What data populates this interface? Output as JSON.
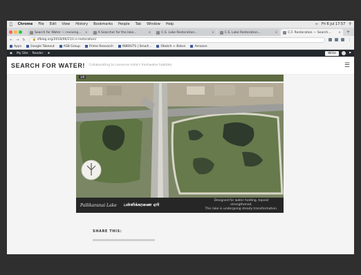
{
  "menubar": {
    "app": "Chrome",
    "items": [
      "File",
      "Edit",
      "View",
      "History",
      "Bookmarks",
      "People",
      "Tab",
      "Window",
      "Help"
    ],
    "clock": "Fri 6 Jul 17:57"
  },
  "tabs": [
    {
      "label": "Search for Water — reviving..."
    },
    {
      "label": "A Searcher for the lake..."
    },
    {
      "label": "C.S. Lake Restoration..."
    },
    {
      "label": "C.S. Lake Restoration..."
    },
    {
      "label": "C.F. Restoration — Search..."
    }
  ],
  "toolbar": {
    "url": "sfblog.org/2018/06/21/c-s-restoration/"
  },
  "bookmarks": [
    "Apps",
    "Google Takeout",
    "ASB Group",
    "Prime Research",
    "INBOUTS | Smart...",
    "Obatch + Baton",
    "Amazon"
  ],
  "adminbar": {
    "site": "My Site",
    "reader": "Reader",
    "write": "Write",
    "colors": {
      "bg": "#23282d"
    }
  },
  "site": {
    "title": "SEARCH FOR WATER!",
    "tagline": "Collaborating to conserve India's freshwater habitats."
  },
  "figure": {
    "badge": "3/6",
    "caption_left": "Pallikaranai Lake",
    "caption_tamil": "பள்ளிக்கரணை ஏரி",
    "caption_right_line1": "Designed for water holding, topsoil strengthened.",
    "caption_right_line2": "This lake is undergoing steady transformation."
  },
  "share_label": "SHARE THIS:"
}
